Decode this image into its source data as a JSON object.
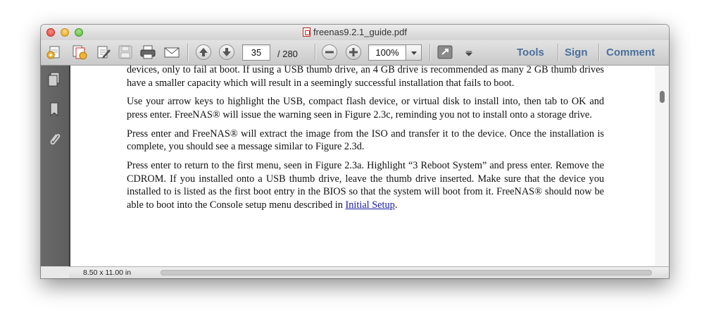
{
  "window": {
    "title": "freenas9.2.1_guide.pdf"
  },
  "toolbar": {
    "icons": [
      "create-pdf-icon",
      "combine-files-icon",
      "edit-icon",
      "save-icon",
      "print-icon",
      "email-icon",
      "page-up-icon",
      "page-down-icon",
      "zoom-out-icon",
      "zoom-in-icon",
      "expand-icon",
      "more-tools-icon"
    ],
    "page_current": "35",
    "page_total": "/ 280",
    "zoom_value": "100%",
    "tools_label": "Tools",
    "sign_label": "Sign",
    "comment_label": "Comment",
    "link_color": "#4a6f9c"
  },
  "sidebar": {
    "icons": [
      "pages-icon",
      "bookmark-icon",
      "attachment-icon"
    ]
  },
  "document": {
    "paragraphs": [
      "devices, only to fail at boot. If using a USB thumb drive, an 4 GB drive is recommended as many 2 GB thumb drives have a smaller capacity which will result in a seemingly successful installation that fails to boot.",
      "Use your arrow keys to highlight the USB, compact flash device, or virtual disk to install into, then tab to OK and press enter. FreeNAS® will issue the warning seen in Figure 2.3c, reminding you not to install onto a storage drive.",
      "Press enter and FreeNAS® will extract the image from the ISO and transfer it to the device. Once the installation is complete, you should see a message similar to Figure 2.3d.",
      "Press enter to return to the first menu, seen in Figure 2.3a. Highlight “3 Reboot System” and press enter. Remove the CDROM. If you installed onto a USB thumb drive, leave the thumb drive inserted. Make sure that the device you installed to is listed as the first boot entry in the BIOS so that the system will boot from it. FreeNAS® should now be able to boot into the Console setup menu described in"
    ],
    "link_text": "Initial Setup",
    "link_suffix": ".",
    "link_color": "#1a1aa8"
  },
  "statusbar": {
    "page_size": "8.50 x 11.00 in"
  }
}
